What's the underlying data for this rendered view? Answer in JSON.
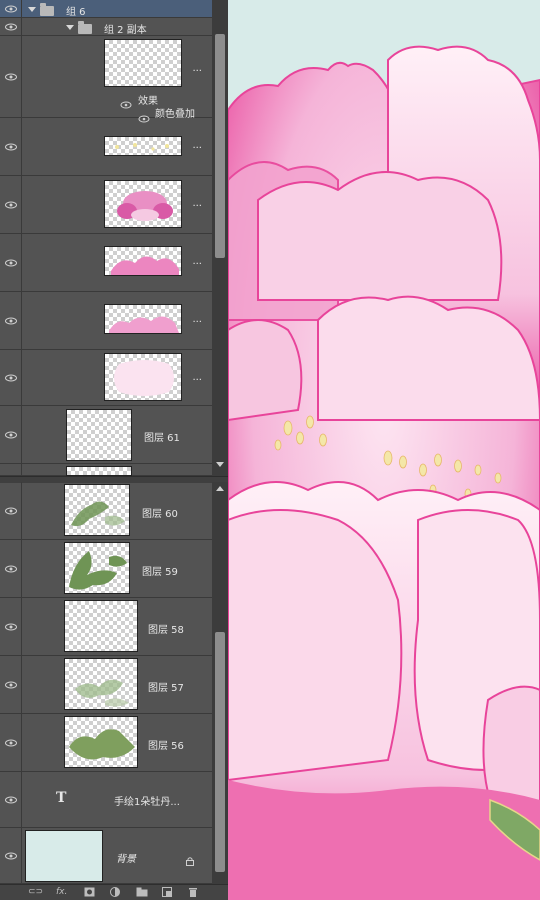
{
  "layers_panel": {
    "group_top": {
      "name": "组 6"
    },
    "group_sub": {
      "name": "组 2 副本"
    },
    "effects_label": "效果",
    "effect_item": "颜色叠加",
    "more": "...",
    "layers": [
      {
        "name": "图层 61"
      },
      {
        "name": "图层 60"
      },
      {
        "name": "图层 59"
      },
      {
        "name": "图层 58"
      },
      {
        "name": "图层 57"
      },
      {
        "name": "图层 56"
      }
    ],
    "text_layer": {
      "name": "手绘1朵牡丹...",
      "type_glyph": "T"
    },
    "background_layer": {
      "name": "背景"
    },
    "footer": {
      "link": "⊂⊃",
      "fx": "fx."
    }
  },
  "colors": {
    "panel_bg": "#535353",
    "selection": "#4b5f7a",
    "canvas_bg": "#d8ebe9",
    "petal_pink": "#e8449a",
    "leaf_green": "#6f9455"
  }
}
